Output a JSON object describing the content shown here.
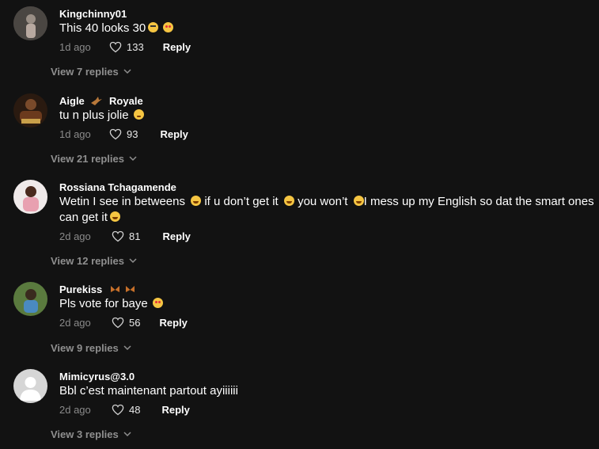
{
  "comments": [
    {
      "username": "Kingchinny01",
      "text": "This 40 looks 30",
      "emojis": [
        "rolling-eyes-emoji",
        "smiling-hearts-emoji"
      ],
      "age": "1d ago",
      "likes": "133",
      "reply_label": "Reply",
      "view_replies": "View 7 replies",
      "avatar_colors": [
        "#3a3a3a",
        "#9a8f86"
      ]
    },
    {
      "username": "Aigle",
      "username_suffix": "Royale",
      "username_icon": "eagle-icon",
      "text": "tu n plus jolie",
      "emojis": [
        "smirking-emoji"
      ],
      "age": "1d ago",
      "likes": "93",
      "reply_label": "Reply",
      "view_replies": "View 21 replies",
      "avatar_colors": [
        "#6b3a1d",
        "#c9a04a"
      ]
    },
    {
      "username": "Rossiana Tchagamende",
      "text_parts": [
        "Wetin I see in betweens",
        "if u don’t get it",
        "you won’t",
        "I mess up my English so dat the smart ones",
        "can get it"
      ],
      "age": "2d ago",
      "likes": "81",
      "reply_label": "Reply",
      "view_replies": "View 12 replies",
      "avatar_colors": [
        "#e9dede",
        "#5a3a2e"
      ]
    },
    {
      "username": "Purekiss",
      "username_icon": "butterfly-icon",
      "text": "Pls vote for baye",
      "emojis": [
        "smiling-hearts-emoji"
      ],
      "age": "2d ago",
      "likes": "56",
      "reply_label": "Reply",
      "view_replies": "View 9 replies",
      "avatar_colors": [
        "#6a8f4a",
        "#3f5a2a"
      ]
    },
    {
      "username": "Mimicyrus@3.0",
      "text": "Bbl c’est maintenant partout ayiiiiii",
      "age": "2d ago",
      "likes": "48",
      "reply_label": "Reply",
      "view_replies": "View 3 replies",
      "avatar_colors": [
        "#d4d4d4",
        "#ffffff"
      ]
    }
  ],
  "icons": {
    "like": "heart-outline-icon",
    "expand": "chevron-down-icon",
    "laugh": "tears-of-joy-emoji"
  },
  "colors": {
    "background": "#121212",
    "muted": "#8a8a8a",
    "text": "#ffffff"
  }
}
